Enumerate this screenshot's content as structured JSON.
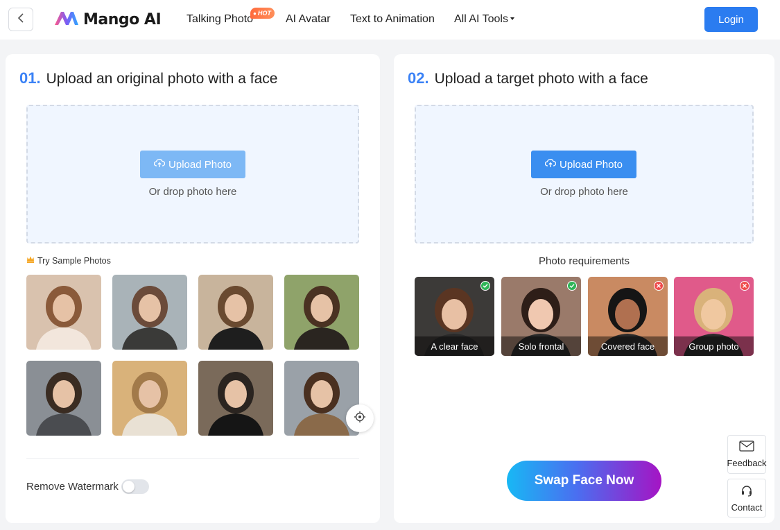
{
  "header": {
    "logo_text": "Mango AI",
    "nav": [
      {
        "label": "Talking Photo",
        "badge": "HOT"
      },
      {
        "label": "AI Avatar"
      },
      {
        "label": "Text to Animation"
      },
      {
        "label": "All AI Tools"
      }
    ],
    "login_label": "Login"
  },
  "left_panel": {
    "step_number": "01.",
    "step_title": "Upload an original photo with a face",
    "upload_button": "Upload Photo",
    "drop_text": "Or drop photo here",
    "sample_label": "Try Sample Photos",
    "sample_photos": [
      {
        "colors": [
          "#d9c2ae",
          "#8a5a3a",
          "#f2e6dc"
        ]
      },
      {
        "colors": [
          "#a9b3b8",
          "#6b4b3a",
          "#3a3a38"
        ]
      },
      {
        "colors": [
          "#c8b49c",
          "#6a4a30",
          "#1e1e1e"
        ]
      },
      {
        "colors": [
          "#8fa36a",
          "#4a3222",
          "#2a2520"
        ]
      },
      {
        "colors": [
          "#8a8f95",
          "#3a2c22",
          "#4a4c50"
        ]
      },
      {
        "colors": [
          "#d9b27a",
          "#a27a4a",
          "#e9e1d4"
        ]
      },
      {
        "colors": [
          "#7a6a5a",
          "#2a2420",
          "#151515"
        ]
      },
      {
        "colors": [
          "#9aa1a8",
          "#4a3020",
          "#8a6a4a"
        ]
      }
    ],
    "watermark_label": "Remove Watermark",
    "watermark_enabled": false
  },
  "right_panel": {
    "step_number": "02.",
    "step_title": "Upload a target photo with a face",
    "upload_button": "Upload Photo",
    "drop_text": "Or drop photo here",
    "requirements_title": "Photo requirements",
    "requirements": [
      {
        "label": "A clear face",
        "ok": true,
        "colors": [
          "#3c3a38",
          "#5a3522",
          "#e8c0a4"
        ]
      },
      {
        "label": "Solo frontal",
        "ok": true,
        "colors": [
          "#9a7a6a",
          "#2e1e18",
          "#f0c8b0"
        ]
      },
      {
        "label": "Covered face",
        "ok": false,
        "colors": [
          "#c98a62",
          "#151515",
          "#b07050"
        ]
      },
      {
        "label": "Group photo",
        "ok": false,
        "colors": [
          "#e05a8a",
          "#d9b27a",
          "#f0c8a0"
        ]
      }
    ],
    "swap_button": "Swap Face Now"
  },
  "side": {
    "feedback_label": "Feedback",
    "contact_label": "Contact"
  },
  "colors": {
    "accent": "#2b7cf0",
    "step_number": "#3b82f6",
    "upload_disabled": "#7db8f5",
    "upload_enabled": "#3a8ef0",
    "ok": "#2fb457",
    "bad": "#ef4b4b"
  }
}
